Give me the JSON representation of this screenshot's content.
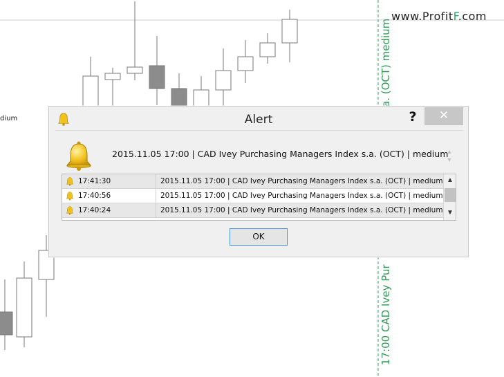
{
  "watermark": {
    "prefix": "www.Profit",
    "accent": "F",
    "suffix": ".com"
  },
  "chart_labels": {
    "upper_vertical": "a. (OCT) medium",
    "lower_vertical": "17:00 CAD Ivey Pur",
    "left_truncated": "dium"
  },
  "dialog": {
    "title": "Alert",
    "help_label": "?",
    "close_label": "✕",
    "message": "2015.11.05  17:00 | CAD Ivey Purchasing Managers Index s.a. (OCT) | medium",
    "history": [
      {
        "time": "17:41:30",
        "text": "2015.11.05  17:00 | CAD Ivey Purchasing Managers Index s.a. (OCT) | medium"
      },
      {
        "time": "17:40:56",
        "text": "2015.11.05  17:00 | CAD Ivey Purchasing Managers Index s.a. (OCT) | medium"
      },
      {
        "time": "17:40:24",
        "text": "2015.11.05  17:00 | CAD Ivey Purchasing Managers Index s.a. (OCT) | medium"
      }
    ],
    "ok_label": "OK"
  },
  "colors": {
    "label_green": "#2e9b55",
    "bell_gold": "#f2c21c",
    "bearish_candle": "#8c8c8c",
    "bullish_candle": "#ffffff"
  }
}
